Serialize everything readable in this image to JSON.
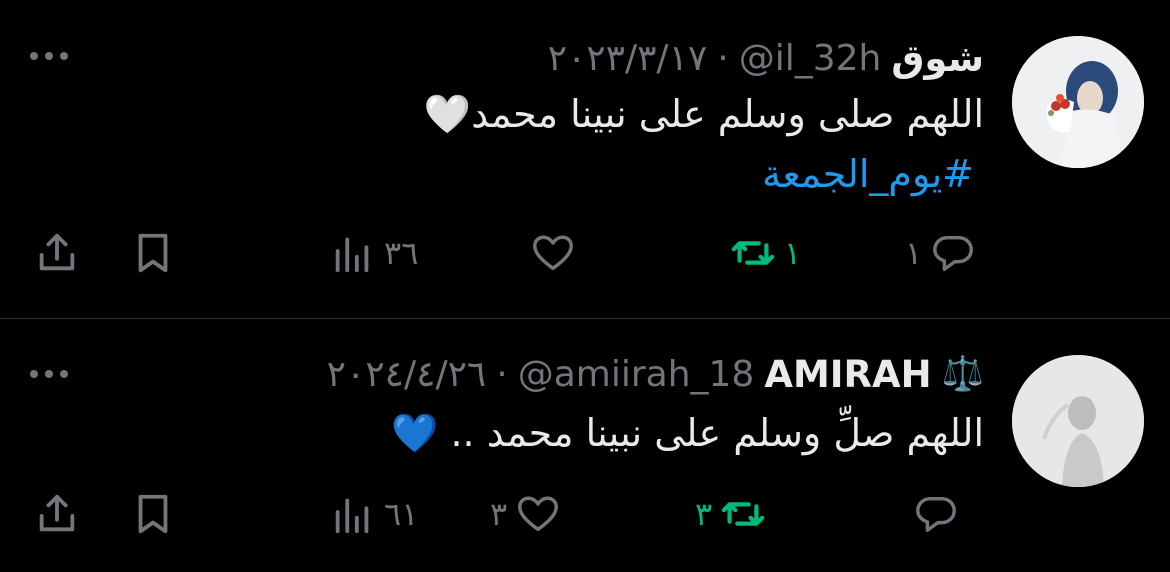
{
  "tweets": [
    {
      "name": "شوق",
      "handle": "@il_32h",
      "separator": "·",
      "date": "٢٠٢٣/٣/١٧",
      "text": "اللهم صلى وسلم على نبينا محمد🤍",
      "hashtag": "#يوم_الجمعة",
      "replies": "١",
      "retweets": "١",
      "likes": "",
      "views": "٣٦"
    },
    {
      "name": "AMIRAH",
      "name_icon": "⚖️",
      "handle": "@amiirah_18",
      "separator": "·",
      "date": "٢٠٢٤/٤/٢٦",
      "text": "اللهم صلِّ وسلم على نبينا محمد .. 💙",
      "replies": "",
      "retweets": "٣",
      "likes": "٣",
      "views": "٦١"
    }
  ],
  "colors": {
    "background": "#000000",
    "text": "#e7e9ea",
    "muted": "#71767b",
    "link": "#1d9bf0",
    "retweet_active": "#00ba7c",
    "divider": "#2f3336"
  }
}
